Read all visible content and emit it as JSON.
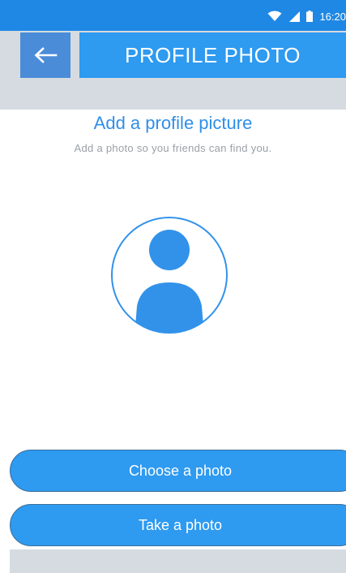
{
  "status_bar": {
    "time": "16:20",
    "icons": [
      "wifi-icon",
      "signal-icon",
      "battery-icon"
    ]
  },
  "header": {
    "back_icon": "arrow-left-icon",
    "title": "PROFILE PHOTO"
  },
  "main": {
    "heading": "Add a profile picture",
    "subheading": "Add a photo so you friends can find you.",
    "avatar_icon": "user-avatar-icon"
  },
  "buttons": {
    "choose_label": "Choose a photo",
    "take_label": "Take a photo"
  },
  "colors": {
    "status_bar": "#1f88e5",
    "title_bar": "#2e9af0",
    "back_button": "#4a8cd8",
    "accent": "#2f8fe8",
    "header_bg": "#d5dbe0"
  }
}
